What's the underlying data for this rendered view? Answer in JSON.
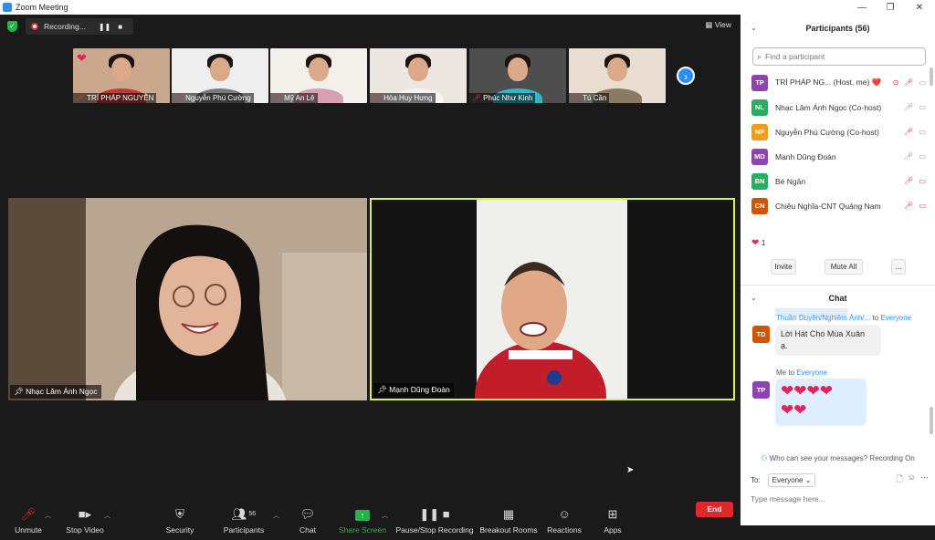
{
  "window": {
    "title": "Zoom Meeting"
  },
  "topbar": {
    "recording_label": "Recording...",
    "view_label": "View"
  },
  "thumbnails": [
    {
      "name": "TRÍ PHÁP NGUYỄN",
      "bg": "#caa88d",
      "shirt": "#c23838",
      "has_heart": true
    },
    {
      "name": "Nguyễn Phú Cường",
      "bg": "#eeeeee",
      "shirt": "#7a7a7a",
      "has_heart": false
    },
    {
      "name": "Mỹ An Lê",
      "bg": "#f3f0ec",
      "shirt": "#d9a0b4",
      "has_heart": false
    },
    {
      "name": "Hòa Huy Hưng",
      "bg": "#ede7e2",
      "shirt": "#f5f5f5",
      "has_heart": false
    },
    {
      "name": "Phúc Như Kinh",
      "bg": "#4e4e4e",
      "shirt": "#30b7c9",
      "has_heart": false
    },
    {
      "name": "Tú Cần",
      "bg": "#e9ddd1",
      "shirt": "#8d7a64",
      "has_heart": false
    }
  ],
  "main_tiles": [
    {
      "name": "Nhạc Lâm Ánh Ngọc"
    },
    {
      "name": "Mạnh Dũng Đoàn"
    }
  ],
  "toolbar": {
    "unmute": "Unmute",
    "stop_video": "Stop Video",
    "security": "Security",
    "participants": "Participants",
    "participants_count": "56",
    "chat": "Chat",
    "share_screen": "Share Screen",
    "recording": "Pause/Stop Recording",
    "breakout": "Breakout Rooms",
    "reactions": "Reactions",
    "apps": "Apps",
    "end": "End"
  },
  "participants_panel": {
    "title": "Participants (56)",
    "search_placeholder": "Find a participant",
    "rows": [
      {
        "initials": "TP",
        "color": "#8e44ad",
        "name": "TRÍ PHÁP NG...  (Host, me) ❤️",
        "mic_muted": true,
        "video_off": false
      },
      {
        "initials": "NL",
        "color": "#27ae60",
        "name": "Nhạc Lâm Ánh Ngọc (Co-host)",
        "mic_muted": false,
        "video_off": false
      },
      {
        "initials": "NP",
        "color": "#f39c12",
        "name": "Nguyễn Phú Cường (Co-host)",
        "mic_muted": true,
        "video_off": false
      },
      {
        "initials": "MD",
        "color": "#8e44ad",
        "name": "Mạnh Dũng Đoàn",
        "mic_muted": false,
        "video_off": false
      },
      {
        "initials": "BN",
        "color": "#27ae60",
        "name": "Bé Ngân",
        "mic_muted": true,
        "video_off": true
      },
      {
        "initials": "CN",
        "color": "#d35400",
        "name": "Chiêu Nghĩa-CNT Quảng Nam",
        "mic_muted": true,
        "video_off": true
      }
    ],
    "reaction_count": "1",
    "invite": "Invite",
    "mute_all": "Mute All",
    "more": "..."
  },
  "chat_panel": {
    "title": "Chat",
    "messages": [
      {
        "initials": "TD",
        "color": "#d35400",
        "sender": "Thuần Duyên/Nghiêm Ánh/...",
        "to_word": "to",
        "recipient": "Everyone",
        "text_line1": "Lời Hát Cho Mùa Xuân",
        "text_line2": "ạ."
      },
      {
        "initials": "TP",
        "color": "#8e44ad",
        "sender": "Me",
        "to_word": "to",
        "recipient": "Everyone",
        "hearts_line1": "❤❤❤❤",
        "hearts_line2": "❤❤"
      }
    ],
    "privacy_note": "Who can see your messages? Recording On",
    "to_label": "To:",
    "to_value": "Everyone",
    "input_placeholder": "Type message here..."
  }
}
